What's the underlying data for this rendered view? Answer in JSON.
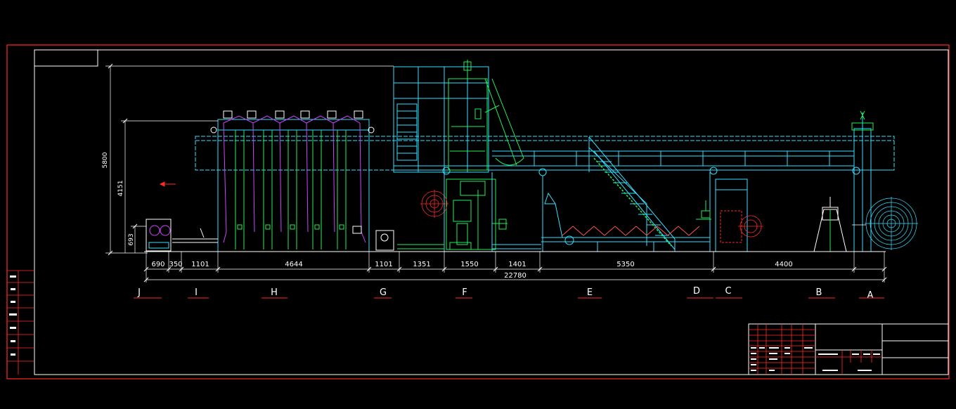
{
  "dimensions": {
    "total_height": "5800",
    "frame_height": "4151",
    "unit_height": "693",
    "segments": [
      "690",
      "350",
      "1101",
      "4644",
      "1101",
      "1351",
      "1550",
      "1401",
      "5350",
      "4400"
    ],
    "total_length": "22780"
  },
  "sections": [
    "J",
    "I",
    "H",
    "G",
    "F",
    "E",
    "D",
    "C",
    "B",
    "A"
  ],
  "colors": {
    "background": "#000000",
    "border": "#ff2a2a",
    "frame": "#ffffff",
    "structure": "#33e0ff",
    "machine": "#22ee55",
    "belt": "#cc44ff",
    "dimension": "#ffffff"
  }
}
